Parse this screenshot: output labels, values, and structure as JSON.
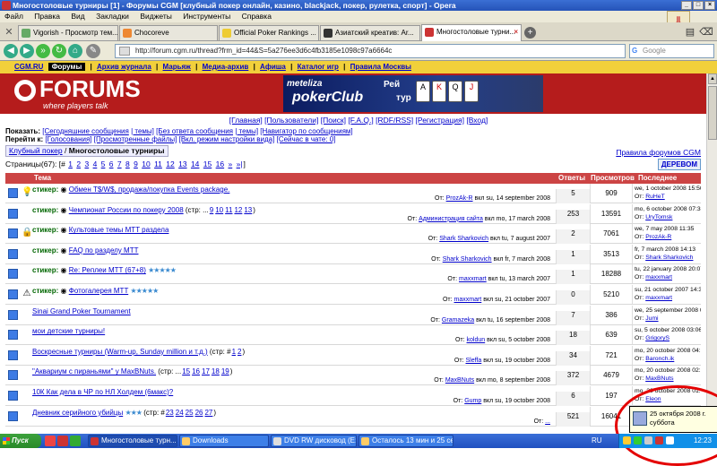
{
  "window": {
    "title": "Многостоловые турниры [1] - Форумы CGM [клубный покер онлайн, казино, blackjack, покер, рулетка, спорт] - Opera"
  },
  "menu": [
    "Файл",
    "Правка",
    "Вид",
    "Закладки",
    "Виджеты",
    "Инструменты",
    "Справка"
  ],
  "tabs": [
    {
      "label": "Vigorish - Просмотр тем...",
      "color": "#6a6"
    },
    {
      "label": "Chocoreve",
      "color": "#e83"
    },
    {
      "label": "Official Poker Rankings ...",
      "color": "#ec3"
    },
    {
      "label": "Азиатский креатив: Ar...",
      "color": "#333"
    },
    {
      "label": "Многостоловые турни...",
      "color": "#c33"
    }
  ],
  "address": {
    "url": "http://forum.cgm.ru/thread?frm_id=44&S=5a276ee3d6c4fb3185e1098c97a6664c"
  },
  "search": {
    "placeholder": "Google"
  },
  "site_nav": {
    "items": [
      "CGM.RU",
      "Форумы",
      "Архив журнала",
      "Марьяж",
      "Медиа-архив",
      "Афиша",
      "Каталог игр",
      "Правила Москвы"
    ],
    "separator": "|"
  },
  "banner": {
    "logo": "FORUMS",
    "tagline": "where players talk",
    "ad_line1": "meteliza",
    "ad_line2": "pokerClub",
    "ad_line3": "Рей",
    "ad_line4": "тур"
  },
  "top_links": [
    "[Главная]",
    "[Пользователи]",
    "[Поиск]",
    "[F.A.Q.]",
    "[RDF/RSS]",
    "[Регистрация]",
    "[Вход]"
  ],
  "show_row": {
    "label": "Показать:",
    "links": [
      "[Сегодняшние сообщения",
      "| темы]",
      "[Без ответа сообщения",
      "| темы]",
      "[Навигатор по сообщениям]"
    ]
  },
  "go_row": {
    "label": "Перейти к:",
    "links": [
      "[Голосования]",
      "[Просмотренные файлы]",
      "[Вкл. режим настройки вида]",
      "[Сейчас в чате: 0]"
    ]
  },
  "breadcrumb": {
    "parent": "Клубный покер",
    "sep": "/",
    "current": "Многостоловые турниры"
  },
  "rules_link": "Правила форумов CGM",
  "pages": {
    "label": "Страницы(67):",
    "current": "#",
    "items": [
      "1",
      "2",
      "3",
      "4",
      "5",
      "6",
      "7",
      "8",
      "9",
      "10",
      "11",
      "12",
      "13",
      "14",
      "15",
      "16",
      "»",
      "»|"
    ]
  },
  "tree_button": "ДЕРЕВОМ",
  "table": {
    "headers": {
      "topic": "Тема",
      "replies": "Ответы",
      "views": "Просмотров",
      "last": "Последнее"
    },
    "rows": [
      {
        "mark": "💡",
        "sticky": "стикер:",
        "poll": "",
        "title": "Обмен T$/W$, продажа/покупка Events package.",
        "pages": [],
        "stars": "",
        "author_prefix": "От:",
        "author": "ProzAk-R",
        "author_date": "вкл su, 14 september 2008",
        "replies": "5",
        "views": "909",
        "last_date": "we, 1 october 2008 15:50",
        "last_user": "RuHeT"
      },
      {
        "mark": "",
        "sticky": "стикер:",
        "poll": "",
        "title": "Чемпионат России по покеру 2008",
        "pages_prefix": "(стр: ...",
        "pages": [
          "9",
          "10",
          "11",
          "12",
          "13"
        ],
        "pages_suffix": ")",
        "stars": "",
        "author_prefix": "От:",
        "author": "Администрация сайта",
        "author_date": "вкл mo, 17 march 2008",
        "replies": "253",
        "views": "13591",
        "last_date": "mo, 6 october 2008 07:38",
        "last_user": "UryTomsk"
      },
      {
        "mark": "🔒",
        "sticky": "стикер:",
        "poll": "",
        "title": "Культовые темы MTT раздела",
        "pages": [],
        "stars": "",
        "author_prefix": "От:",
        "author": "Shark Sharkovich",
        "author_date": "вкл tu, 7 august 2007",
        "replies": "2",
        "views": "7061",
        "last_date": "we, 7 may 2008 11:35",
        "last_user": "ProzAk-R"
      },
      {
        "mark": "",
        "sticky": "стикер:",
        "poll": "",
        "title": "FAQ по разделу MTT",
        "pages": [],
        "stars": "",
        "author_prefix": "От:",
        "author": "Shark Sharkovich",
        "author_date": "вкл fr, 7 march 2008",
        "replies": "1",
        "views": "3513",
        "last_date": "fr, 7 march 2008 14:13",
        "last_user": "Shark Sharkovich"
      },
      {
        "mark": "",
        "sticky": "стикер:",
        "poll": "",
        "title": "Re: Реплеи MTT (67+8)",
        "pages": [],
        "stars": "★★★★★",
        "author_prefix": "От:",
        "author": "maxxmart",
        "author_date": "вкл tu, 13 march 2007",
        "replies": "1",
        "views": "18288",
        "last_date": "tu, 22 january 2008 20:07",
        "last_user": "maxxmart"
      },
      {
        "mark": "⚠",
        "sticky": "стикер:",
        "poll": "",
        "title": "Фотогалерея MTT",
        "pages": [],
        "stars": "★★★★★",
        "author_prefix": "От:",
        "author": "maxxmart",
        "author_date": "вкл su, 21 october 2007",
        "replies": "0",
        "views": "5210",
        "last_date": "su, 21 october 2007 14:37",
        "last_user": "maxxmart"
      },
      {
        "mark": "",
        "sticky": "",
        "poll": "",
        "title": "Sinai Grand Poker Tournament",
        "pages": [],
        "stars": "",
        "author_prefix": "От:",
        "author": "Gramazeka",
        "author_date": "вкл tu, 16 september 2008",
        "replies": "7",
        "views": "386",
        "last_date": "we, 25 september 2008 08:45",
        "last_user": "Jumi"
      },
      {
        "mark": "",
        "sticky": "",
        "poll": "",
        "title": "мои детские турниры!",
        "pages": [],
        "stars": "",
        "author_prefix": "От:",
        "author": "koldun",
        "author_date": "вкл su, 5 october 2008",
        "replies": "18",
        "views": "639",
        "last_date": "su, 5 october 2008 03:06",
        "last_user": "GrigoryS"
      },
      {
        "mark": "",
        "sticky": "",
        "poll": "",
        "title": "Воскресные турниры (Warm-up, Sunday million и т.д.)",
        "pages_prefix": "(стр: #",
        "pages": [
          "1",
          "2"
        ],
        "pages_suffix": ")",
        "stars": "",
        "author_prefix": "От:",
        "author": "Sleffa",
        "author_date": "вкл su, 19 october 2008",
        "replies": "34",
        "views": "721",
        "last_date": "mo, 20 october 2008 04:55",
        "last_user": "Baronch.ik"
      },
      {
        "mark": "",
        "sticky": "",
        "poll": "",
        "title": "\"Аквариум с пираньями\" у MaxBNuts.",
        "pages_prefix": "(стр: ...",
        "pages": [
          "15",
          "16",
          "17",
          "18",
          "19"
        ],
        "pages_suffix": ")",
        "stars": "",
        "author_prefix": "От:",
        "author": "MaxBNuts",
        "author_date": "вкл mo, 8 september 2008",
        "replies": "372",
        "views": "4679",
        "last_date": "mo, 20 october 2008 02:12",
        "last_user": "MaxBNuts"
      },
      {
        "mark": "",
        "sticky": "",
        "poll": "",
        "title": "10К Как дела в ЧР по НЛ Холдем (6макс)?",
        "pages": [],
        "stars": "",
        "author_prefix": "От:",
        "author": "Gump",
        "author_date": "вкл su, 19 october 2008",
        "replies": "6",
        "views": "197",
        "last_date": "mo, 20 october 2008 01:54",
        "last_user": "Eleon"
      },
      {
        "mark": "",
        "sticky": "",
        "poll": "",
        "title": "Дневник серийного убийцы",
        "pages_prefix": "(стр: #",
        "pages": [
          "23",
          "24",
          "25",
          "26",
          "27"
        ],
        "pages_suffix": ")",
        "stars": "★★★",
        "author_prefix": "От:",
        "author": "...",
        "author_date": "",
        "replies": "521",
        "views": "16041",
        "last_date": "",
        "last_user": ""
      }
    ]
  },
  "tooltip": {
    "line1": "25 октября 2008 г.",
    "line2": "суббота"
  },
  "taskbar": {
    "start": "Пуск",
    "buttons": [
      "Многостоловые турн...",
      "Downloads",
      "DVD RW дисковод (E:)",
      "Осталось 13 мин и 25 сек"
    ],
    "lang": "RU",
    "clock": "12:23"
  },
  "colors": {
    "accent": "#cc4444",
    "site_nav": "#f1d03b",
    "banner": "#b51c1c",
    "link": "#0000cc"
  }
}
